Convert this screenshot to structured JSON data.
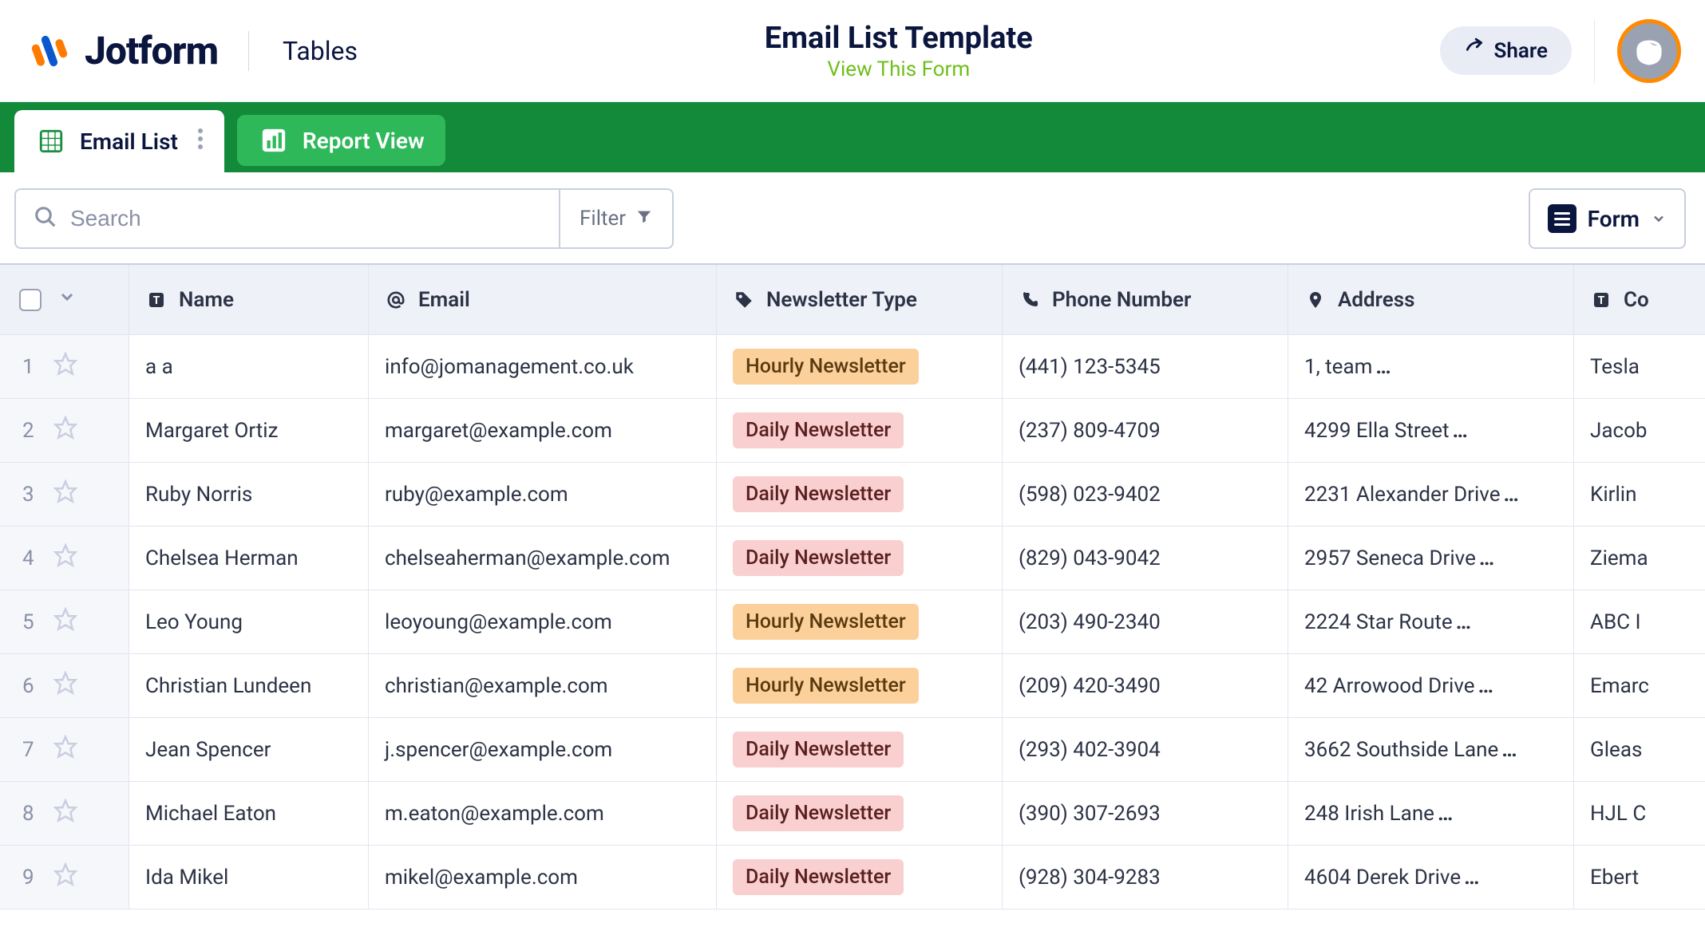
{
  "app": {
    "brand": "Jotform",
    "section": "Tables"
  },
  "header": {
    "title": "Email List Template",
    "view_form": "View This Form",
    "share_label": "Share"
  },
  "tabs": {
    "email_list": "Email List",
    "report_view": "Report View"
  },
  "toolbar": {
    "search_placeholder": "Search",
    "filter_label": "Filter",
    "form_button": "Form"
  },
  "columns": {
    "name": "Name",
    "email": "Email",
    "newsletter": "Newsletter Type",
    "phone": "Phone Number",
    "address": "Address",
    "company": "Co"
  },
  "newsletter_tags": {
    "hourly": "Hourly Newsletter",
    "daily": "Daily Newsletter"
  },
  "rows": [
    {
      "n": "1",
      "name": "a a",
      "email": "info@jomanagement.co.uk",
      "type": "hourly",
      "phone": "(441) 123-5345",
      "address": "1, team",
      "company": "Tesla"
    },
    {
      "n": "2",
      "name": "Margaret Ortiz",
      "email": "margaret@example.com",
      "type": "daily",
      "phone": "(237) 809-4709",
      "address": "4299 Ella Street",
      "company": "Jacob"
    },
    {
      "n": "3",
      "name": "Ruby Norris",
      "email": "ruby@example.com",
      "type": "daily",
      "phone": "(598) 023-9402",
      "address": "2231 Alexander Drive",
      "company": "Kirlin"
    },
    {
      "n": "4",
      "name": "Chelsea Herman",
      "email": "chelseaherman@example.com",
      "type": "daily",
      "phone": "(829) 043-9042",
      "address": "2957 Seneca Drive",
      "company": "Ziema"
    },
    {
      "n": "5",
      "name": "Leo Young",
      "email": "leoyoung@example.com",
      "type": "hourly",
      "phone": "(203) 490-2340",
      "address": "2224 Star Route",
      "company": "ABC I"
    },
    {
      "n": "6",
      "name": "Christian Lundeen",
      "email": "christian@example.com",
      "type": "hourly",
      "phone": "(209) 420-3490",
      "address": "42 Arrowood Drive",
      "company": "Emarc"
    },
    {
      "n": "7",
      "name": "Jean Spencer",
      "email": "j.spencer@example.com",
      "type": "daily",
      "phone": "(293) 402-3904",
      "address": "3662 Southside Lane",
      "company": "Gleas"
    },
    {
      "n": "8",
      "name": "Michael Eaton",
      "email": "m.eaton@example.com",
      "type": "daily",
      "phone": "(390) 307-2693",
      "address": "248 Irish Lane",
      "company": "HJL C"
    },
    {
      "n": "9",
      "name": "Ida Mikel",
      "email": "mikel@example.com",
      "type": "daily",
      "phone": "(928) 304-9283",
      "address": "4604 Derek Drive",
      "company": "Ebert"
    }
  ]
}
